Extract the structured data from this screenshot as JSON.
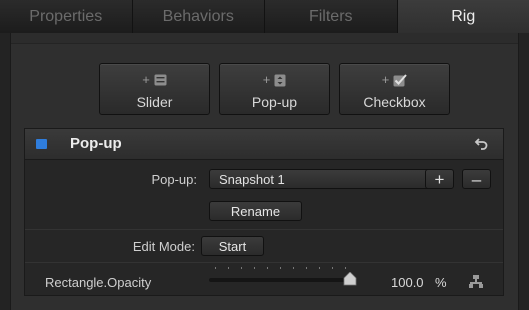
{
  "tabs": [
    {
      "label": "Properties",
      "active": false
    },
    {
      "label": "Behaviors",
      "active": false
    },
    {
      "label": "Filters",
      "active": false
    },
    {
      "label": "Rig",
      "active": true
    }
  ],
  "add_widgets": [
    {
      "label": "Slider",
      "icon": "slider-widget-icon"
    },
    {
      "label": "Pop-up",
      "icon": "popup-widget-icon"
    },
    {
      "label": "Checkbox",
      "icon": "checkbox-widget-icon"
    }
  ],
  "widget": {
    "title": "Pop-up",
    "popup_label": "Pop-up:",
    "popup_value": "Snapshot 1",
    "add_label": "+",
    "remove_label": "–",
    "rename_label": "Rename",
    "edit_mode_label": "Edit Mode:",
    "start_label": "Start",
    "param_label": "Rectangle.Opacity",
    "param_value": "100.0",
    "param_unit": "%",
    "param_fraction": 1.0
  },
  "colors": {
    "accent_blue": "#2f7ddc"
  }
}
